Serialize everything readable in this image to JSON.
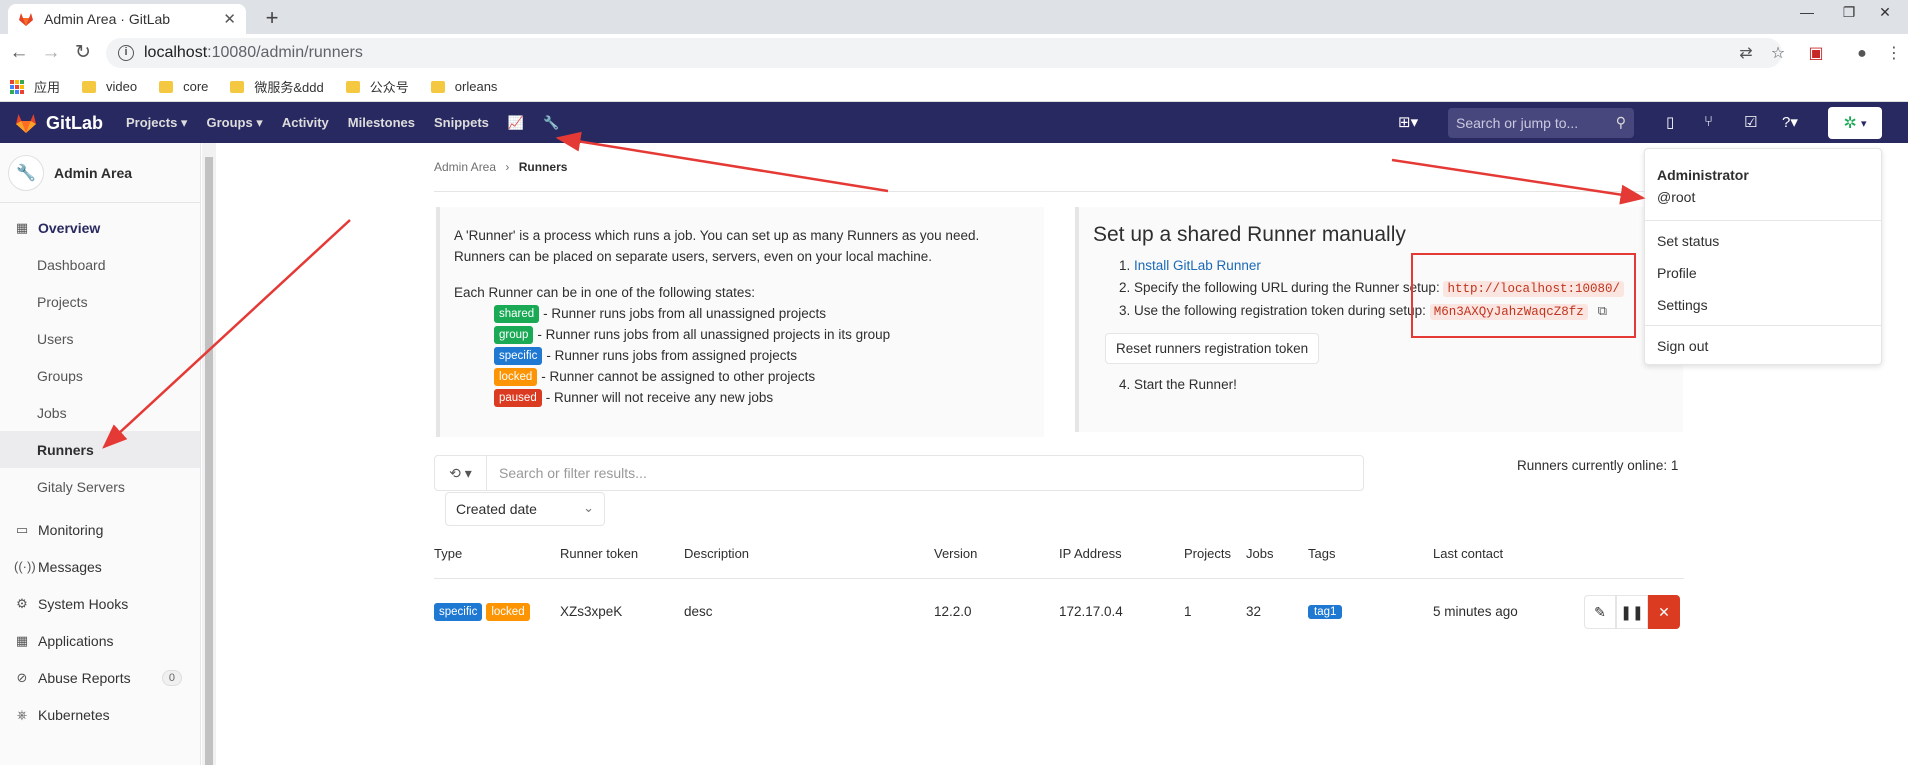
{
  "browser": {
    "tab_title": "Admin Area · GitLab",
    "tab_close": "✕",
    "new_tab": "+",
    "address_host": "localhost",
    "address_path": ":10080/admin/runners",
    "bookmarks": [
      "应用",
      "video",
      "core",
      "微服务&ddd",
      "公众号",
      "orleans"
    ]
  },
  "header": {
    "brand": "GitLab",
    "nav": [
      "Projects ▾",
      "Groups ▾",
      "Activity",
      "Milestones",
      "Snippets"
    ],
    "search_placeholder": "Search or jump to..."
  },
  "sidebar": {
    "title": "Admin Area",
    "section_overview": "Overview",
    "sub_items": [
      "Dashboard",
      "Projects",
      "Users",
      "Groups",
      "Jobs",
      "Runners",
      "Gitaly Servers"
    ],
    "items": [
      {
        "label": "Monitoring",
        "icon": "monitor-icon"
      },
      {
        "label": "Messages",
        "icon": "broadcast-icon"
      },
      {
        "label": "System Hooks",
        "icon": "hook-icon"
      },
      {
        "label": "Applications",
        "icon": "apps-icon"
      },
      {
        "label": "Abuse Reports",
        "icon": "report-icon",
        "badge": "0"
      },
      {
        "label": "Kubernetes",
        "icon": "kubernetes-icon"
      }
    ]
  },
  "breadcrumb": {
    "root": "Admin Area",
    "sep": "›",
    "current": "Runners"
  },
  "info": {
    "line1": "A 'Runner' is a process which runs a job. You can set up as many Runners as you need.",
    "line2": "Runners can be placed on separate users, servers, even on your local machine.",
    "states_intro": "Each Runner can be in one of the following states:",
    "states": [
      {
        "badge": "shared",
        "text": "- Runner runs jobs from all unassigned projects"
      },
      {
        "badge": "group",
        "text": "- Runner runs jobs from all unassigned projects in its group"
      },
      {
        "badge": "specific",
        "text": "- Runner runs jobs from assigned projects"
      },
      {
        "badge": "locked",
        "text": "- Runner cannot be assigned to other projects"
      },
      {
        "badge": "paused",
        "text": "- Runner will not receive any new jobs"
      }
    ]
  },
  "setup": {
    "title": "Set up a shared Runner manually",
    "step1_link": "Install GitLab Runner",
    "step2_text": "Specify the following URL during the Runner setup:",
    "step2_url": "http://localhost:10080/",
    "step3_text": "Use the following registration token during setup:",
    "step3_token": "M6n3AXQyJahzWaqcZ8fz",
    "reset_button": "Reset runners registration token",
    "step4_text": "Start the Runner!"
  },
  "filter": {
    "placeholder": "Search or filter results...",
    "sort_label": "Created date"
  },
  "online_text": "Runners currently online: 1",
  "table": {
    "headers": [
      "Type",
      "Runner token",
      "Description",
      "Version",
      "IP Address",
      "Projects",
      "Jobs",
      "Tags",
      "Last contact"
    ],
    "rows": [
      {
        "type_badges": [
          "specific",
          "locked"
        ],
        "token": "XZs3xpeK",
        "description": "desc",
        "version": "12.2.0",
        "ip": "172.17.0.4",
        "projects": "1",
        "jobs": "32",
        "tag": "tag1",
        "last_contact": "5 minutes ago"
      }
    ]
  },
  "user_menu": {
    "name": "Administrator",
    "handle": "@root",
    "items": [
      "Set status",
      "Profile",
      "Settings",
      "Sign out"
    ]
  },
  "colors": {
    "header_bg": "#292961",
    "accent": "#1f78d1",
    "annotation": "#e53935"
  }
}
